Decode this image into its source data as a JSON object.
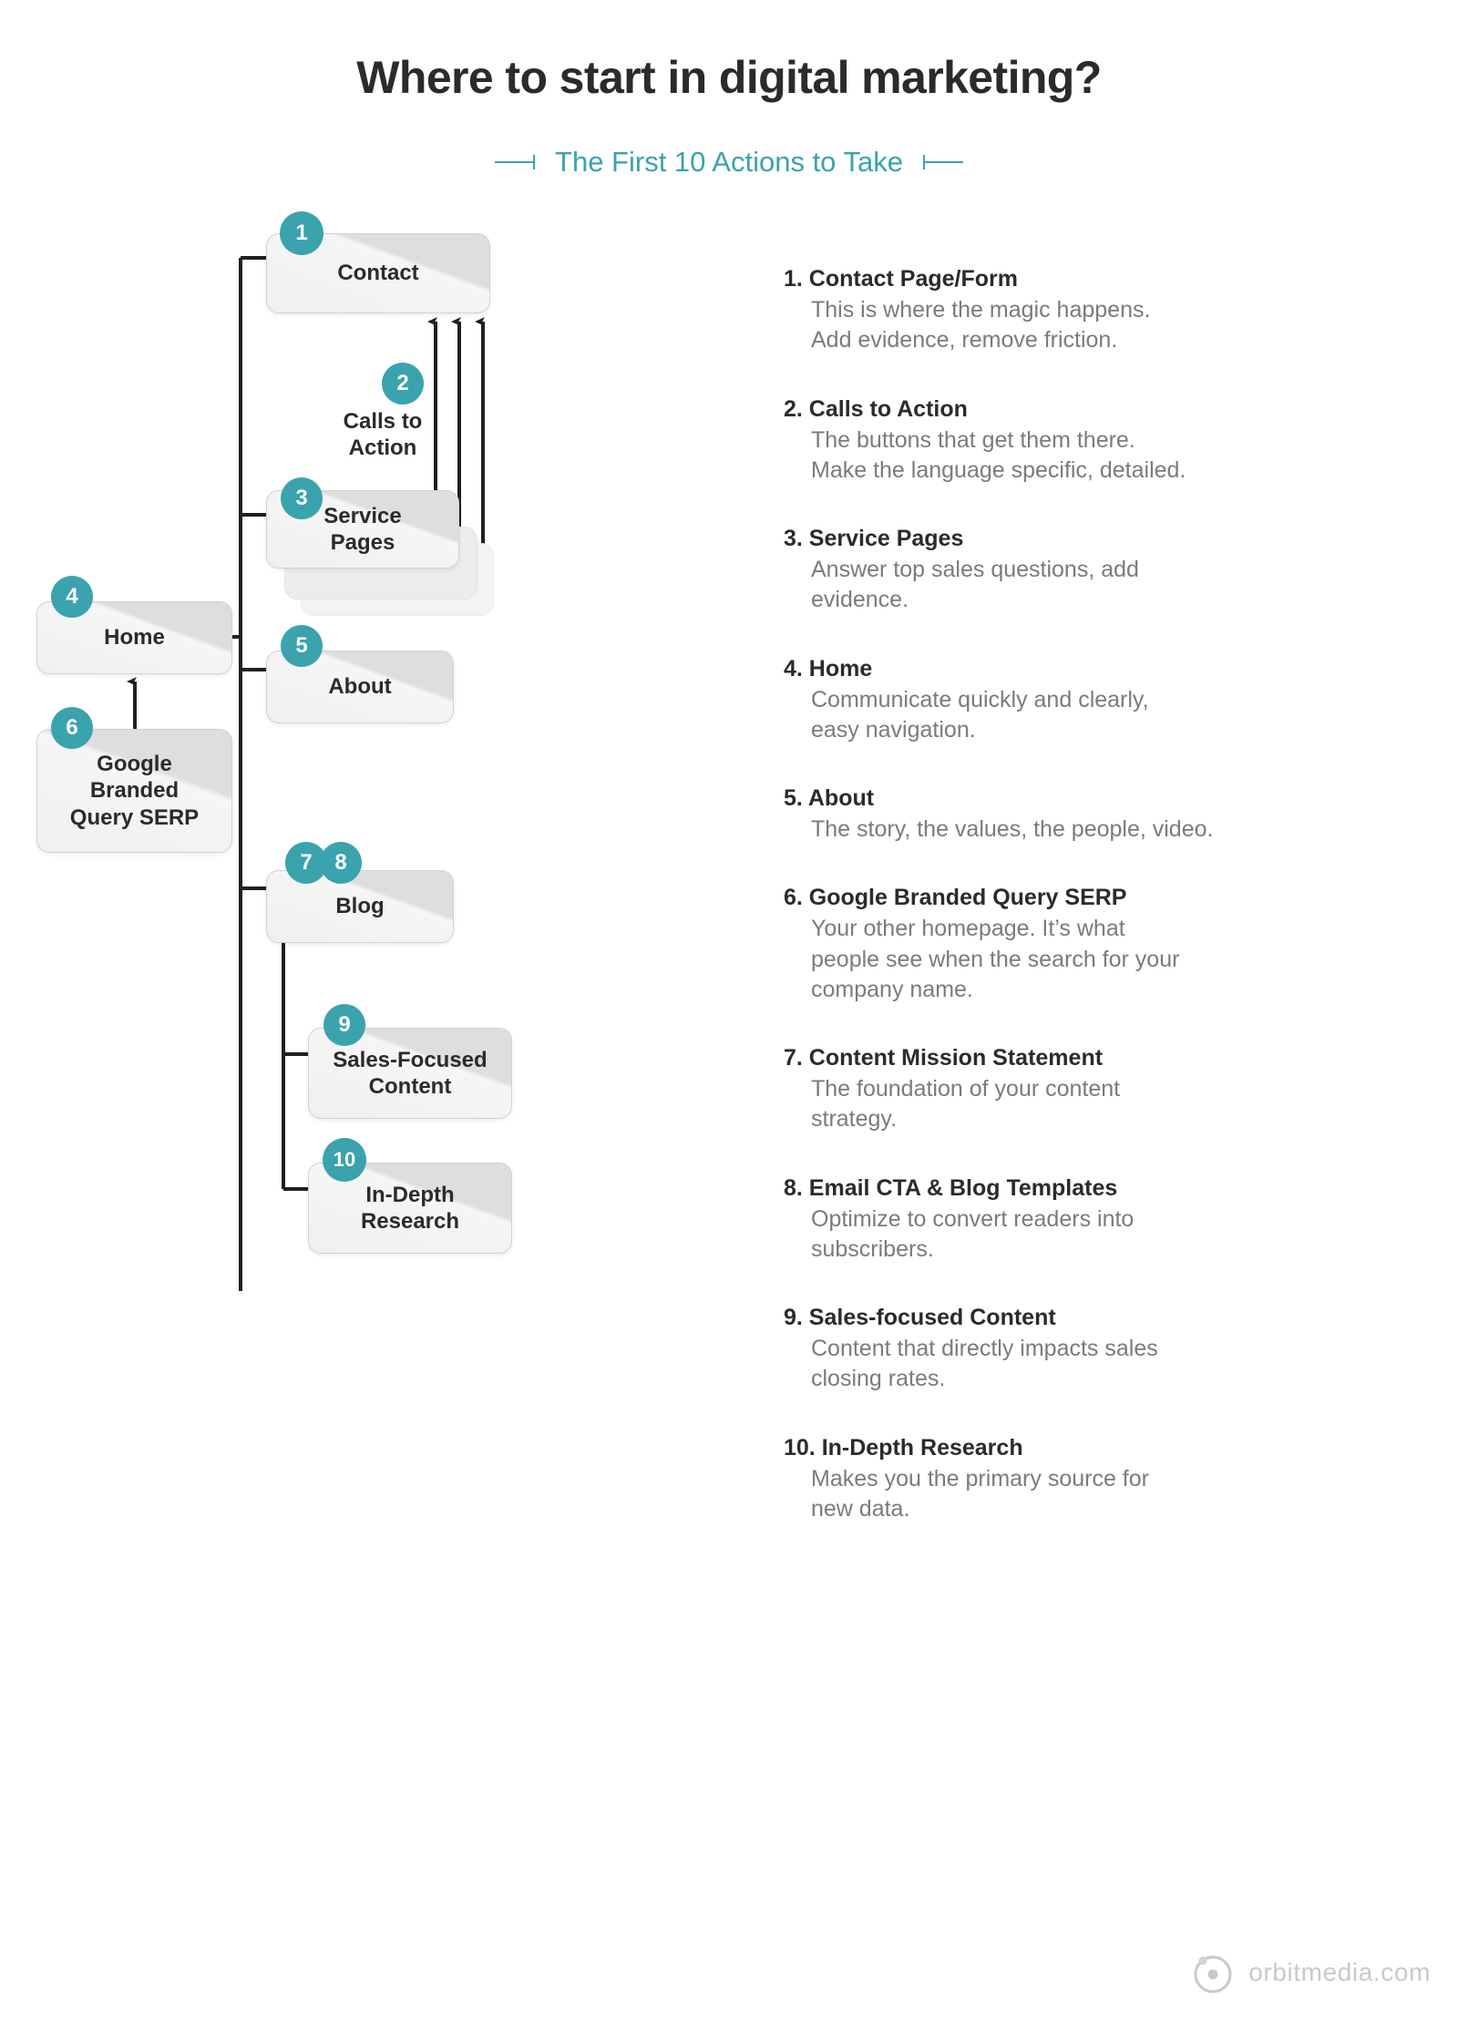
{
  "header": {
    "title": "Where to start in digital marketing?",
    "subtitle": "The First 10 Actions to Take"
  },
  "diagram": {
    "nodes": [
      {
        "id": "contact",
        "label": "Contact",
        "badges": [
          "1"
        ]
      },
      {
        "id": "cta",
        "label": "Calls to\nAction",
        "badges": [
          "2"
        ]
      },
      {
        "id": "service",
        "label": "Service\nPages",
        "badges": [
          "3"
        ]
      },
      {
        "id": "home",
        "label": "Home",
        "badges": [
          "4"
        ]
      },
      {
        "id": "about",
        "label": "About",
        "badges": [
          "5"
        ]
      },
      {
        "id": "serp",
        "label": "Google\nBranded\nQuery SERP",
        "badges": [
          "6"
        ]
      },
      {
        "id": "blog",
        "label": "Blog",
        "badges": [
          "7",
          "8"
        ]
      },
      {
        "id": "sales",
        "label": "Sales-Focused\nContent",
        "badges": [
          "9"
        ]
      },
      {
        "id": "research",
        "label": "In-Depth\nResearch",
        "badges": [
          "10"
        ]
      }
    ],
    "node_labels": {
      "contact": "Contact",
      "cta_line1": "Calls to",
      "cta_line2": "Action",
      "service_line1": "Service",
      "service_line2": "Pages",
      "home": "Home",
      "about": "About",
      "serp_line1": "Google",
      "serp_line2": "Branded",
      "serp_line3": "Query SERP",
      "blog": "Blog",
      "sales_line1": "Sales-Focused",
      "sales_line2": "Content",
      "research_line1": "In-Depth",
      "research_line2": "Research"
    },
    "badges": {
      "b1": "1",
      "b2": "2",
      "b3": "3",
      "b4": "4",
      "b5": "5",
      "b6": "6",
      "b7": "7",
      "b8": "8",
      "b9": "9",
      "b10": "10"
    }
  },
  "list": {
    "items": [
      {
        "heading": "1. Contact Page/Form",
        "body": "This is where the magic happens.\nAdd evidence, remove friction.",
        "body_line1": "This is where the magic happens.",
        "body_line2": "Add evidence, remove friction."
      },
      {
        "heading": "2. Calls to Action",
        "body": "The buttons that get them there.\nMake the language specific, detailed.",
        "body_line1": "The buttons that get them there.",
        "body_line2": "Make the language specific, detailed."
      },
      {
        "heading": "3. Service Pages",
        "body": "Answer top sales questions, add\nevidence.",
        "body_line1": "Answer top sales questions, add",
        "body_line2": "evidence."
      },
      {
        "heading": "4. Home",
        "body": "Communicate quickly and clearly,\neasy navigation.",
        "body_line1": "Communicate quickly and clearly,",
        "body_line2": "easy navigation."
      },
      {
        "heading": "5. About",
        "body": "The story, the values, the people, video.",
        "body_line1": "The story, the values, the people, video.",
        "body_line2": ""
      },
      {
        "heading": "6. Google Branded Query SERP",
        "body": "Your other homepage. It’s what\npeople see when the search for your\ncompany name.",
        "body_line1": "Your other homepage. It’s what",
        "body_line2": "people see when the search for your",
        "body_line3": "company name."
      },
      {
        "heading": "7. Content Mission Statement",
        "body": "The foundation of your content\nstrategy.",
        "body_line1": "The foundation of your content",
        "body_line2": "strategy."
      },
      {
        "heading": "8. Email CTA & Blog Templates",
        "body": "Optimize to convert readers into\nsubscribers.",
        "body_line1": "Optimize to convert readers into",
        "body_line2": "subscribers."
      },
      {
        "heading": "9. Sales-focused Content",
        "body": "Content that directly impacts sales\nclosing rates.",
        "body_line1": "Content that directly impacts sales",
        "body_line2": "closing rates."
      },
      {
        "heading": "10. In-Depth Research",
        "body": "Makes you the primary source for\nnew data.",
        "body_line1": "Makes you the primary source for",
        "body_line2": "new data."
      }
    ]
  },
  "footer": {
    "brand": "orbitmedia.com",
    "icon": "orbit-icon"
  },
  "colors": {
    "accent": "#3aa3ad",
    "node_fill": "#dedede",
    "heading_text": "#2b2b2b",
    "body_text": "#7b7b7b",
    "footer_text": "#c9c9c9"
  }
}
